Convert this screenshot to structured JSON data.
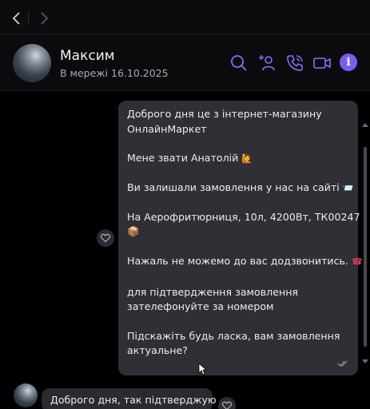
{
  "window": {
    "title_bar_color": "#ffffff"
  },
  "nav": {
    "back_icon": "chevron-left-icon",
    "forward_icon": "chevron-right-icon"
  },
  "header": {
    "name": "Максим",
    "status": "В мережі 16.10.2025",
    "actions": [
      {
        "icon": "search-icon"
      },
      {
        "icon": "add-participant-icon"
      },
      {
        "icon": "phone-icon"
      },
      {
        "icon": "video-call-icon"
      },
      {
        "icon": "info-icon",
        "glyph": "i"
      }
    ],
    "accent": "#7b5cf0"
  },
  "messages": {
    "outgoing": {
      "lines": [
        "Доброго дня це з інтернет-магазину",
        "ОнлайнМаркет",
        "Мене звати Анатолій",
        "Ви залишали замовлення у нас на сайті",
        "На  Аерофритюрниця, 10л, 4200Вт, ТК00247",
        "Нажаль не можемо до вас додзвонитись.",
        "для підтвердження замовлення",
        "зателефонуйте за номером",
        "Підскажіть будь ласка, вам замовлення",
        "актуальне?"
      ],
      "emoji": {
        "person": "🙋",
        "envelope": "📨",
        "package": "📦",
        "phone": "☎"
      },
      "status_icon": "read-check-icon"
    },
    "incoming": {
      "text": "Доброго дня, так підтверджую"
    }
  },
  "colors": {
    "bubble_out": "#2f2f35",
    "bubble_in": "#2a2a2f",
    "background": "#000000"
  }
}
